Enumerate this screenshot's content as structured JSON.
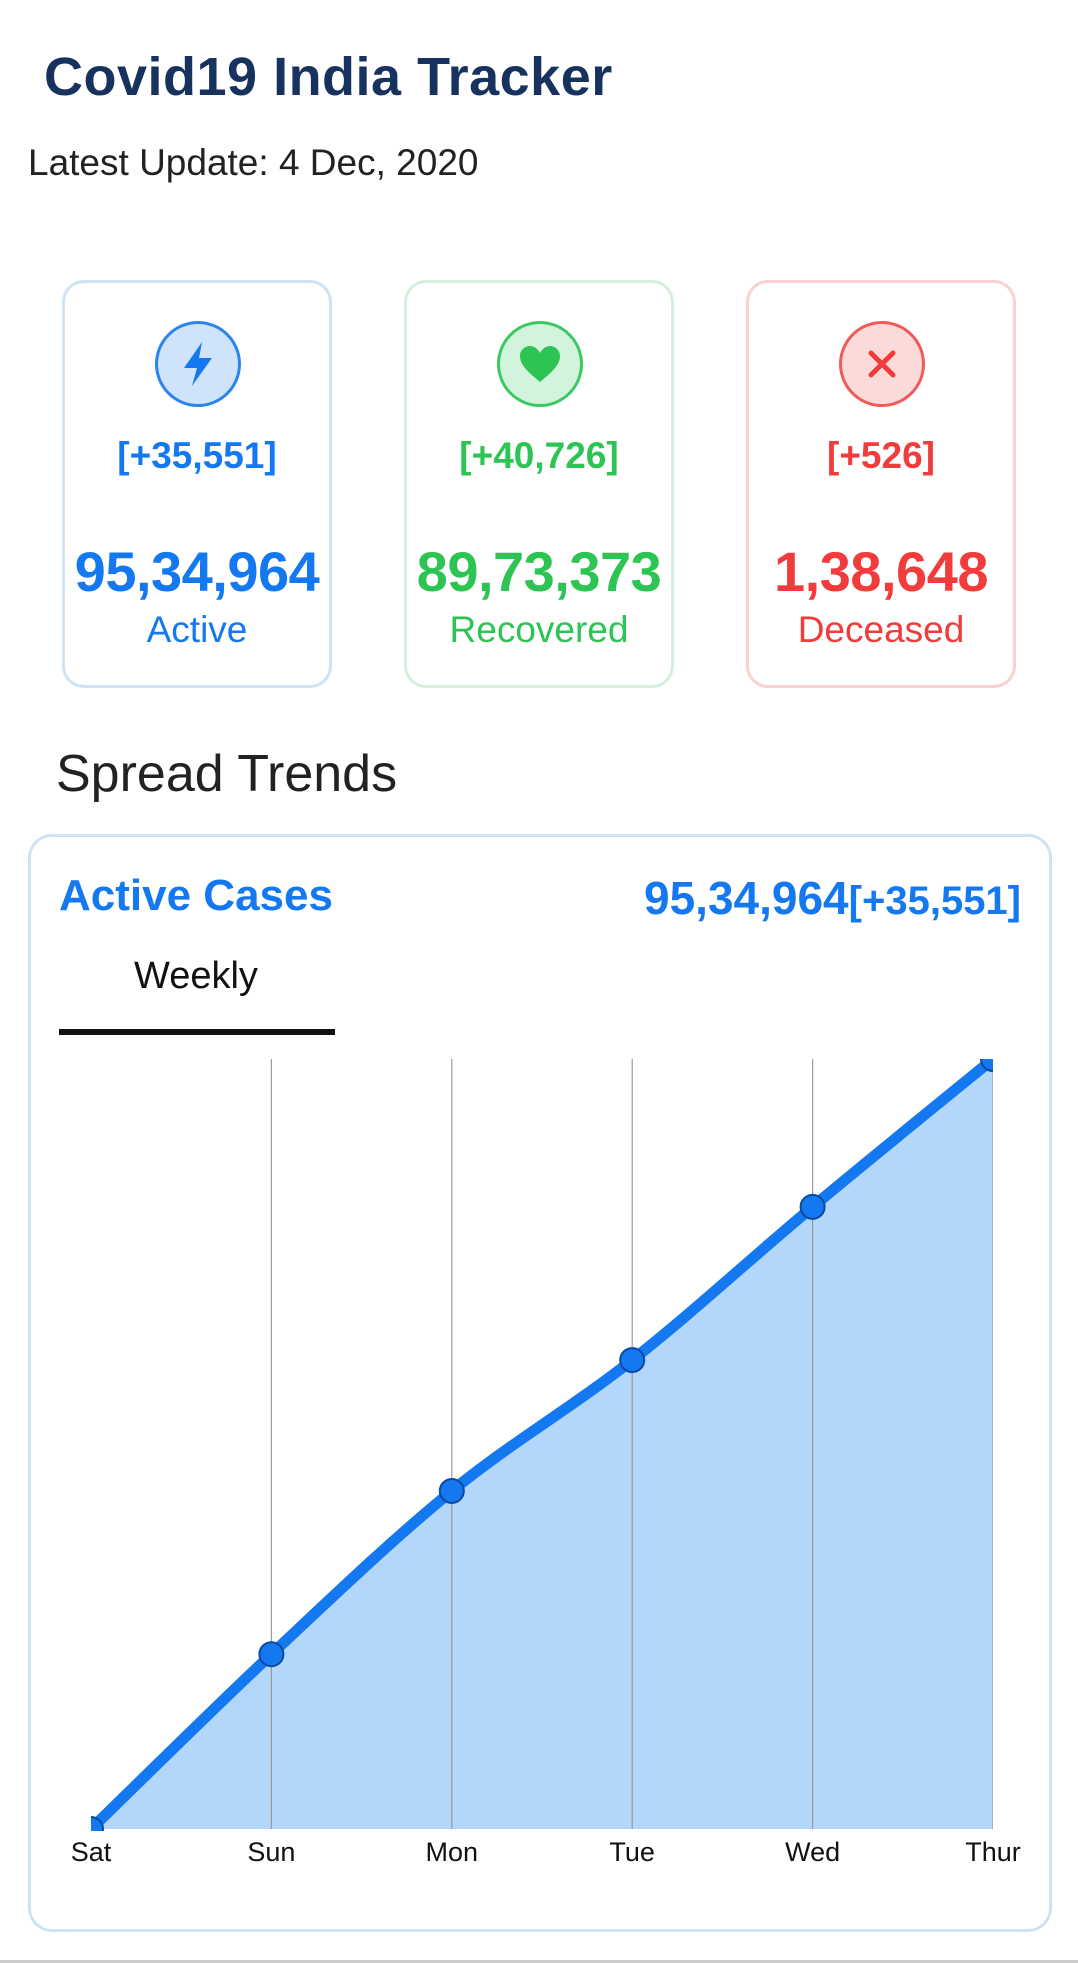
{
  "header": {
    "title": "Covid19 India Tracker",
    "latest_update": "Latest Update: 4 Dec, 2020"
  },
  "stats": {
    "active": {
      "delta": "[+35,551]",
      "value": "95,34,964",
      "label": "Active",
      "icon": "bolt-icon",
      "color": "#1478f0"
    },
    "recovered": {
      "delta": "[+40,726]",
      "value": "89,73,373",
      "label": "Recovered",
      "icon": "heart-icon",
      "color": "#2ec453"
    },
    "deceased": {
      "delta": "[+526]",
      "value": "1,38,648",
      "label": "Deceased",
      "icon": "close-icon",
      "color": "#f23b3b"
    }
  },
  "trends": {
    "section_title": "Spread Trends",
    "card_title": "Active Cases",
    "total_value": "95,34,964",
    "total_delta": "[+35,551]",
    "tab_label": "Weekly"
  },
  "chart_data": {
    "type": "area",
    "categories": [
      "Sat",
      "Sun",
      "Mon",
      "Tue",
      "Wed",
      "Thur"
    ],
    "series": [
      {
        "values": [
          0,
          0.227,
          0.439,
          0.609,
          0.808,
          1.0
        ]
      }
    ],
    "grid": "vertical",
    "legend": "none",
    "line_color": "#1478f0",
    "fill_color": "#b3d6fb"
  }
}
